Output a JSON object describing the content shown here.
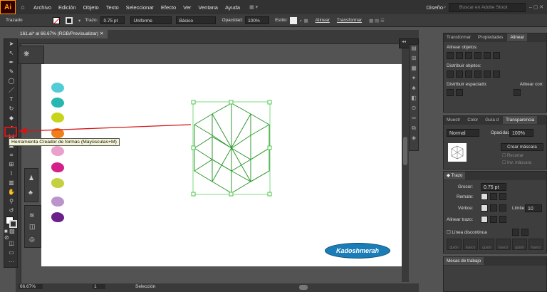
{
  "app": {
    "logo": "Ai"
  },
  "menu": [
    "Archivo",
    "Edición",
    "Objeto",
    "Texto",
    "Seleccionar",
    "Efecto",
    "Ver",
    "Ventana",
    "Ayuda"
  ],
  "workspace": {
    "label": "Diseño",
    "search_placeholder": "Buscar en Adobe Stock"
  },
  "control": {
    "selection_label": "Trazado",
    "stroke_label": "Trazo:",
    "stroke_value": "0.75 pt",
    "profile": "Uniforme",
    "brush": "Básico",
    "opacity_label": "Opacidad:",
    "opacity_value": "100%",
    "style_label": "Estilo:",
    "align_label": "Alinear",
    "transform_label": "Transformar"
  },
  "document": {
    "tab": "161.ai* al 66.67% (RGB/Previsualizar)"
  },
  "status": {
    "zoom": "66.67%",
    "page": "1",
    "mode": "Selección"
  },
  "tooltip": "Herramienta Creador de formas (Mayúsculas+M)",
  "brand": "Kadoshmerah",
  "ruler": {
    "top_end": "1400"
  },
  "blob_colors": [
    "#52ccd6",
    "#26b7b0",
    "#c8d41c",
    "#f07f1a",
    "#eaa0cc",
    "#d4208a",
    "#c5d040",
    "#bb94cc",
    "#6b1f8a"
  ],
  "align_panel": {
    "tabs": [
      "Transformar",
      "Propiedades",
      "Alinear"
    ],
    "align_objects": "Alinear objetos:",
    "distribute_objects": "Distribuir objetos:",
    "distribute_spacing": "Distribuir espaciado:",
    "align_to": "Alinear con:"
  },
  "transparency_panel": {
    "tabs": [
      "Muestr",
      "Color",
      "Guía d",
      "Transparencia"
    ],
    "mode": "Normal",
    "opacity_label": "Opacidad:",
    "opacity_value": "100%",
    "mask_button": "Crear máscara",
    "clip": "Recortar",
    "invert": "Inv. máscara"
  },
  "stroke_panel": {
    "title": "Trazo",
    "weight_label": "Grosor:",
    "weight_value": "0.75 pt",
    "cap_label": "Remate:",
    "corner_label": "Vértice:",
    "limit_label": "Límite:",
    "limit_value": "10",
    "align_label": "Alinear trazo:",
    "dashed_label": "Línea discontinua",
    "dash_fields": [
      "guión",
      "hueco",
      "guión",
      "hueco",
      "guión",
      "hueco"
    ]
  },
  "worksets": {
    "title": "Mesas de trabajo"
  }
}
